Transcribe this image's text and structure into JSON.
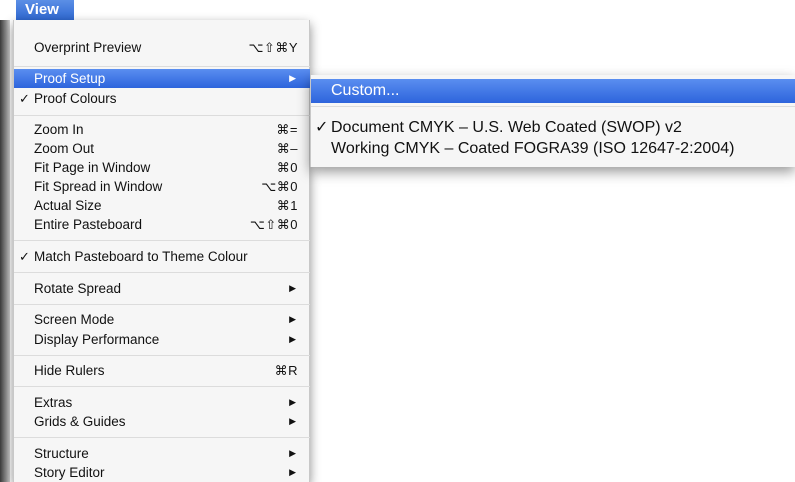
{
  "menu_title": "View",
  "menu": {
    "overprint_preview": {
      "label": "Overprint Preview",
      "shortcut": "⌥⇧⌘Y"
    },
    "proof_setup": {
      "label": "Proof Setup",
      "arrow": "▶"
    },
    "proof_colours": {
      "label": "Proof Colours",
      "check": "✓"
    },
    "zoom_in": {
      "label": "Zoom In",
      "shortcut": "⌘="
    },
    "zoom_out": {
      "label": "Zoom Out",
      "shortcut": "⌘–"
    },
    "fit_page": {
      "label": "Fit Page in Window",
      "shortcut": "⌘0"
    },
    "fit_spread": {
      "label": "Fit Spread in Window",
      "shortcut": "⌥⌘0"
    },
    "actual_size": {
      "label": "Actual Size",
      "shortcut": "⌘1"
    },
    "entire_pasteboard": {
      "label": "Entire Pasteboard",
      "shortcut": "⌥⇧⌘0"
    },
    "match_pasteboard": {
      "label": "Match Pasteboard to Theme Colour",
      "check": "✓"
    },
    "rotate_spread": {
      "label": "Rotate Spread",
      "arrow": "▶"
    },
    "screen_mode": {
      "label": "Screen Mode",
      "arrow": "▶"
    },
    "display_performance": {
      "label": "Display Performance",
      "arrow": "▶"
    },
    "hide_rulers": {
      "label": "Hide Rulers",
      "shortcut": "⌘R"
    },
    "extras": {
      "label": "Extras",
      "arrow": "▶"
    },
    "grids_guides": {
      "label": "Grids & Guides",
      "arrow": "▶"
    },
    "structure": {
      "label": "Structure",
      "arrow": "▶"
    },
    "story_editor": {
      "label": "Story Editor",
      "arrow": "▶"
    }
  },
  "submenu": {
    "custom": {
      "label": "Custom..."
    },
    "document_cmyk": {
      "label": "Document CMYK – U.S. Web Coated (SWOP) v2",
      "check": "✓"
    },
    "working_cmyk": {
      "label": "Working CMYK – Coated FOGRA39 (ISO 12647-2:2004)"
    }
  },
  "colors": {
    "highlight": "#3875d7",
    "menu_bg": "#f6f6f6"
  }
}
